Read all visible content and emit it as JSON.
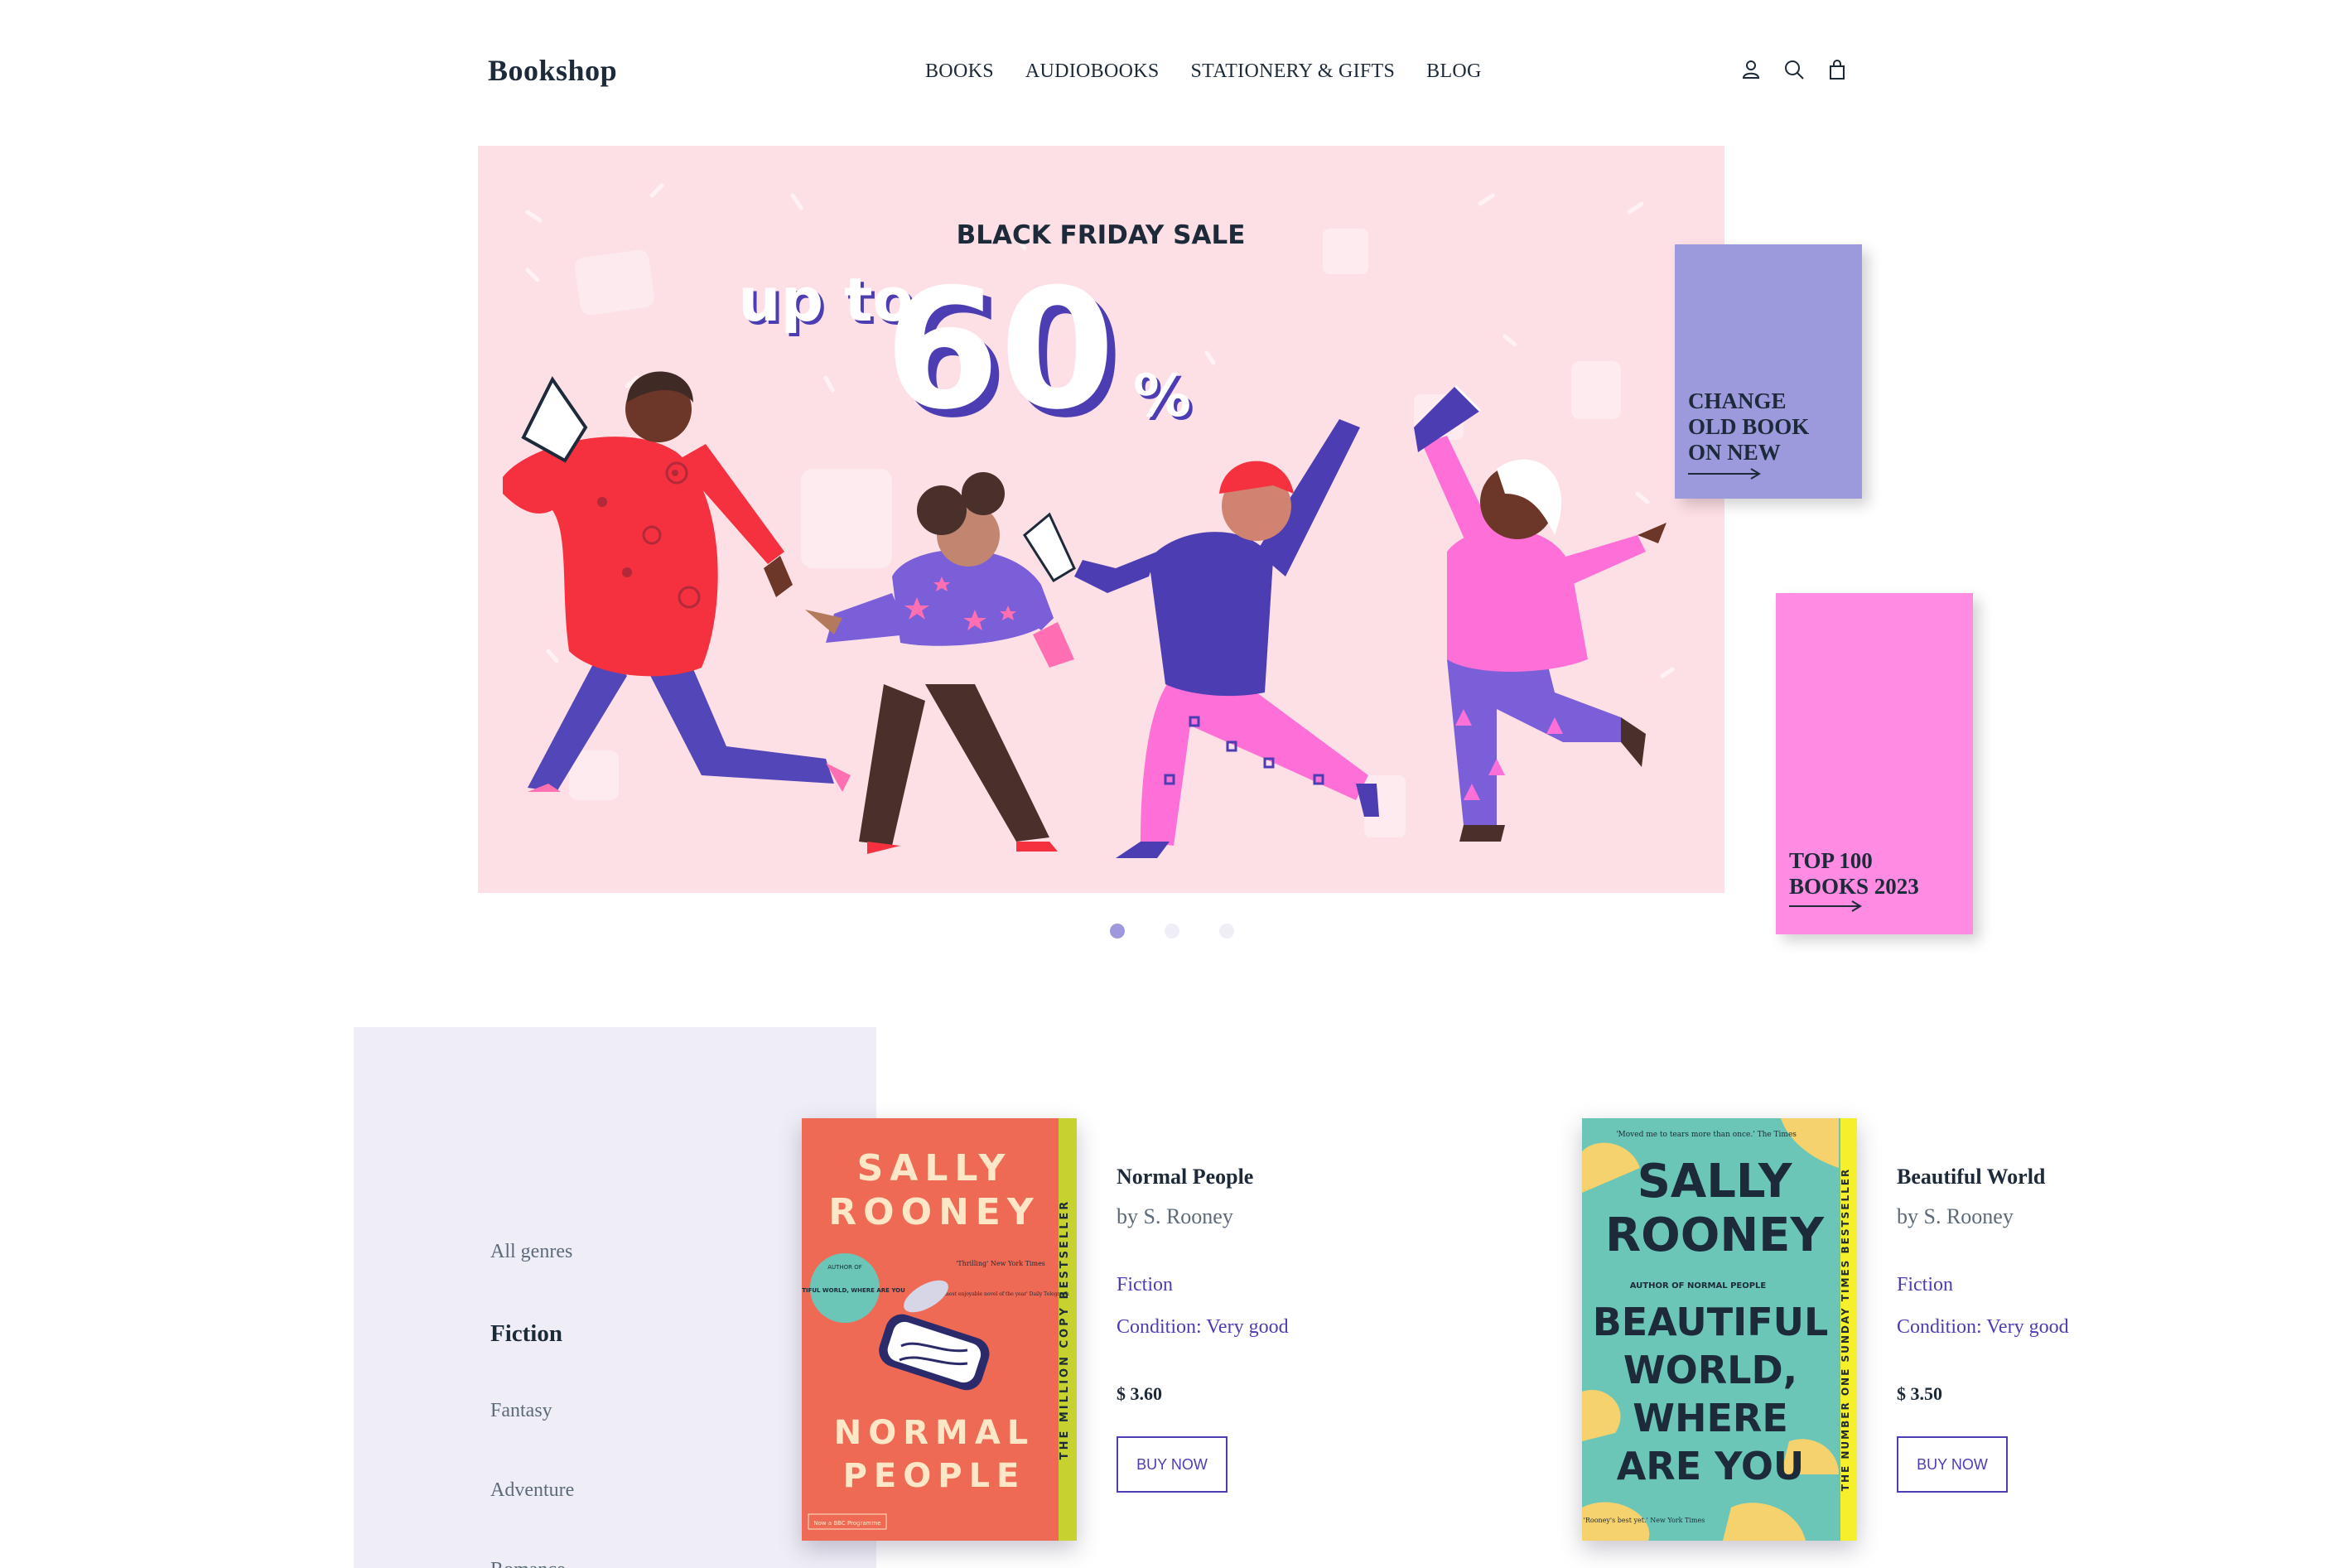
{
  "header": {
    "logo": "Bookshop",
    "nav": [
      "BOOKS",
      "AUDIOBOOKS",
      "STATIONERY & GIFTS",
      "BLOG"
    ],
    "icons": [
      "user-icon",
      "search-icon",
      "shopping-bag-icon"
    ]
  },
  "banner": {
    "headline": "BLACK FRIDAY SALE",
    "up_to": "up to",
    "percent_value": "60",
    "percent_sign": "%"
  },
  "promos": {
    "left": {
      "lines": [
        "CHANGE",
        "OLD BOOK",
        "ON NEW"
      ]
    },
    "right": {
      "lines": [
        "TOP 100",
        "BOOKS 2023"
      ]
    }
  },
  "slider": {
    "count": 3,
    "active": 0
  },
  "sidebar": {
    "genres": [
      "All genres",
      "Fiction",
      "Fantasy",
      "Adventure",
      "Romance"
    ],
    "active": "Fiction"
  },
  "books": [
    {
      "title": "Normal People",
      "author": "by S. Rooney",
      "genre": "Fiction",
      "condition": "Condition: Very good",
      "price": "$ 3.60",
      "button": "BUY NOW",
      "cover": {
        "author_first": "SALLY",
        "author_last": "ROONEY",
        "title_first": "NORMAL",
        "title_second": "PEOPLE",
        "spine": "THE MILLION COPY BESTSELLER",
        "badge": "BEAUTIFUL WORLD, WHERE ARE YOU",
        "badge_top": "AUTHOR OF",
        "quote1": "'Thrilling' New York Times",
        "quote2": "'The most enjoyable novel of the year' Daily Telegraph",
        "footer": "Now a BBC Programme",
        "bg": "#ef6a55"
      }
    },
    {
      "title": "Beautiful World",
      "author": "by S. Rooney",
      "genre": "Fiction",
      "condition": "Condition: Very good",
      "price": "$ 3.50",
      "button": "BUY NOW",
      "cover": {
        "author_first": "SALLY",
        "author_last": "ROONEY",
        "subtitle": "AUTHOR OF NORMAL PEOPLE",
        "title_lines": [
          "BEAUTIFUL",
          "WORLD,",
          "WHERE",
          "ARE YOU"
        ],
        "spine": "THE NUMBER ONE SUNDAY TIMES BESTSELLER",
        "quote_top": "'Moved me to tears more than once.' The Times",
        "quote_bottom": "'Rooney's best yet.' New York Times",
        "bg": "#6bc6b8"
      }
    }
  ],
  "colors": {
    "accent": "#4c3db2",
    "banner_bg": "#fde0e6",
    "promo_purple": "#9d99dd",
    "promo_pink": "#ff8be2",
    "sidebar_bg": "#efeef6"
  }
}
